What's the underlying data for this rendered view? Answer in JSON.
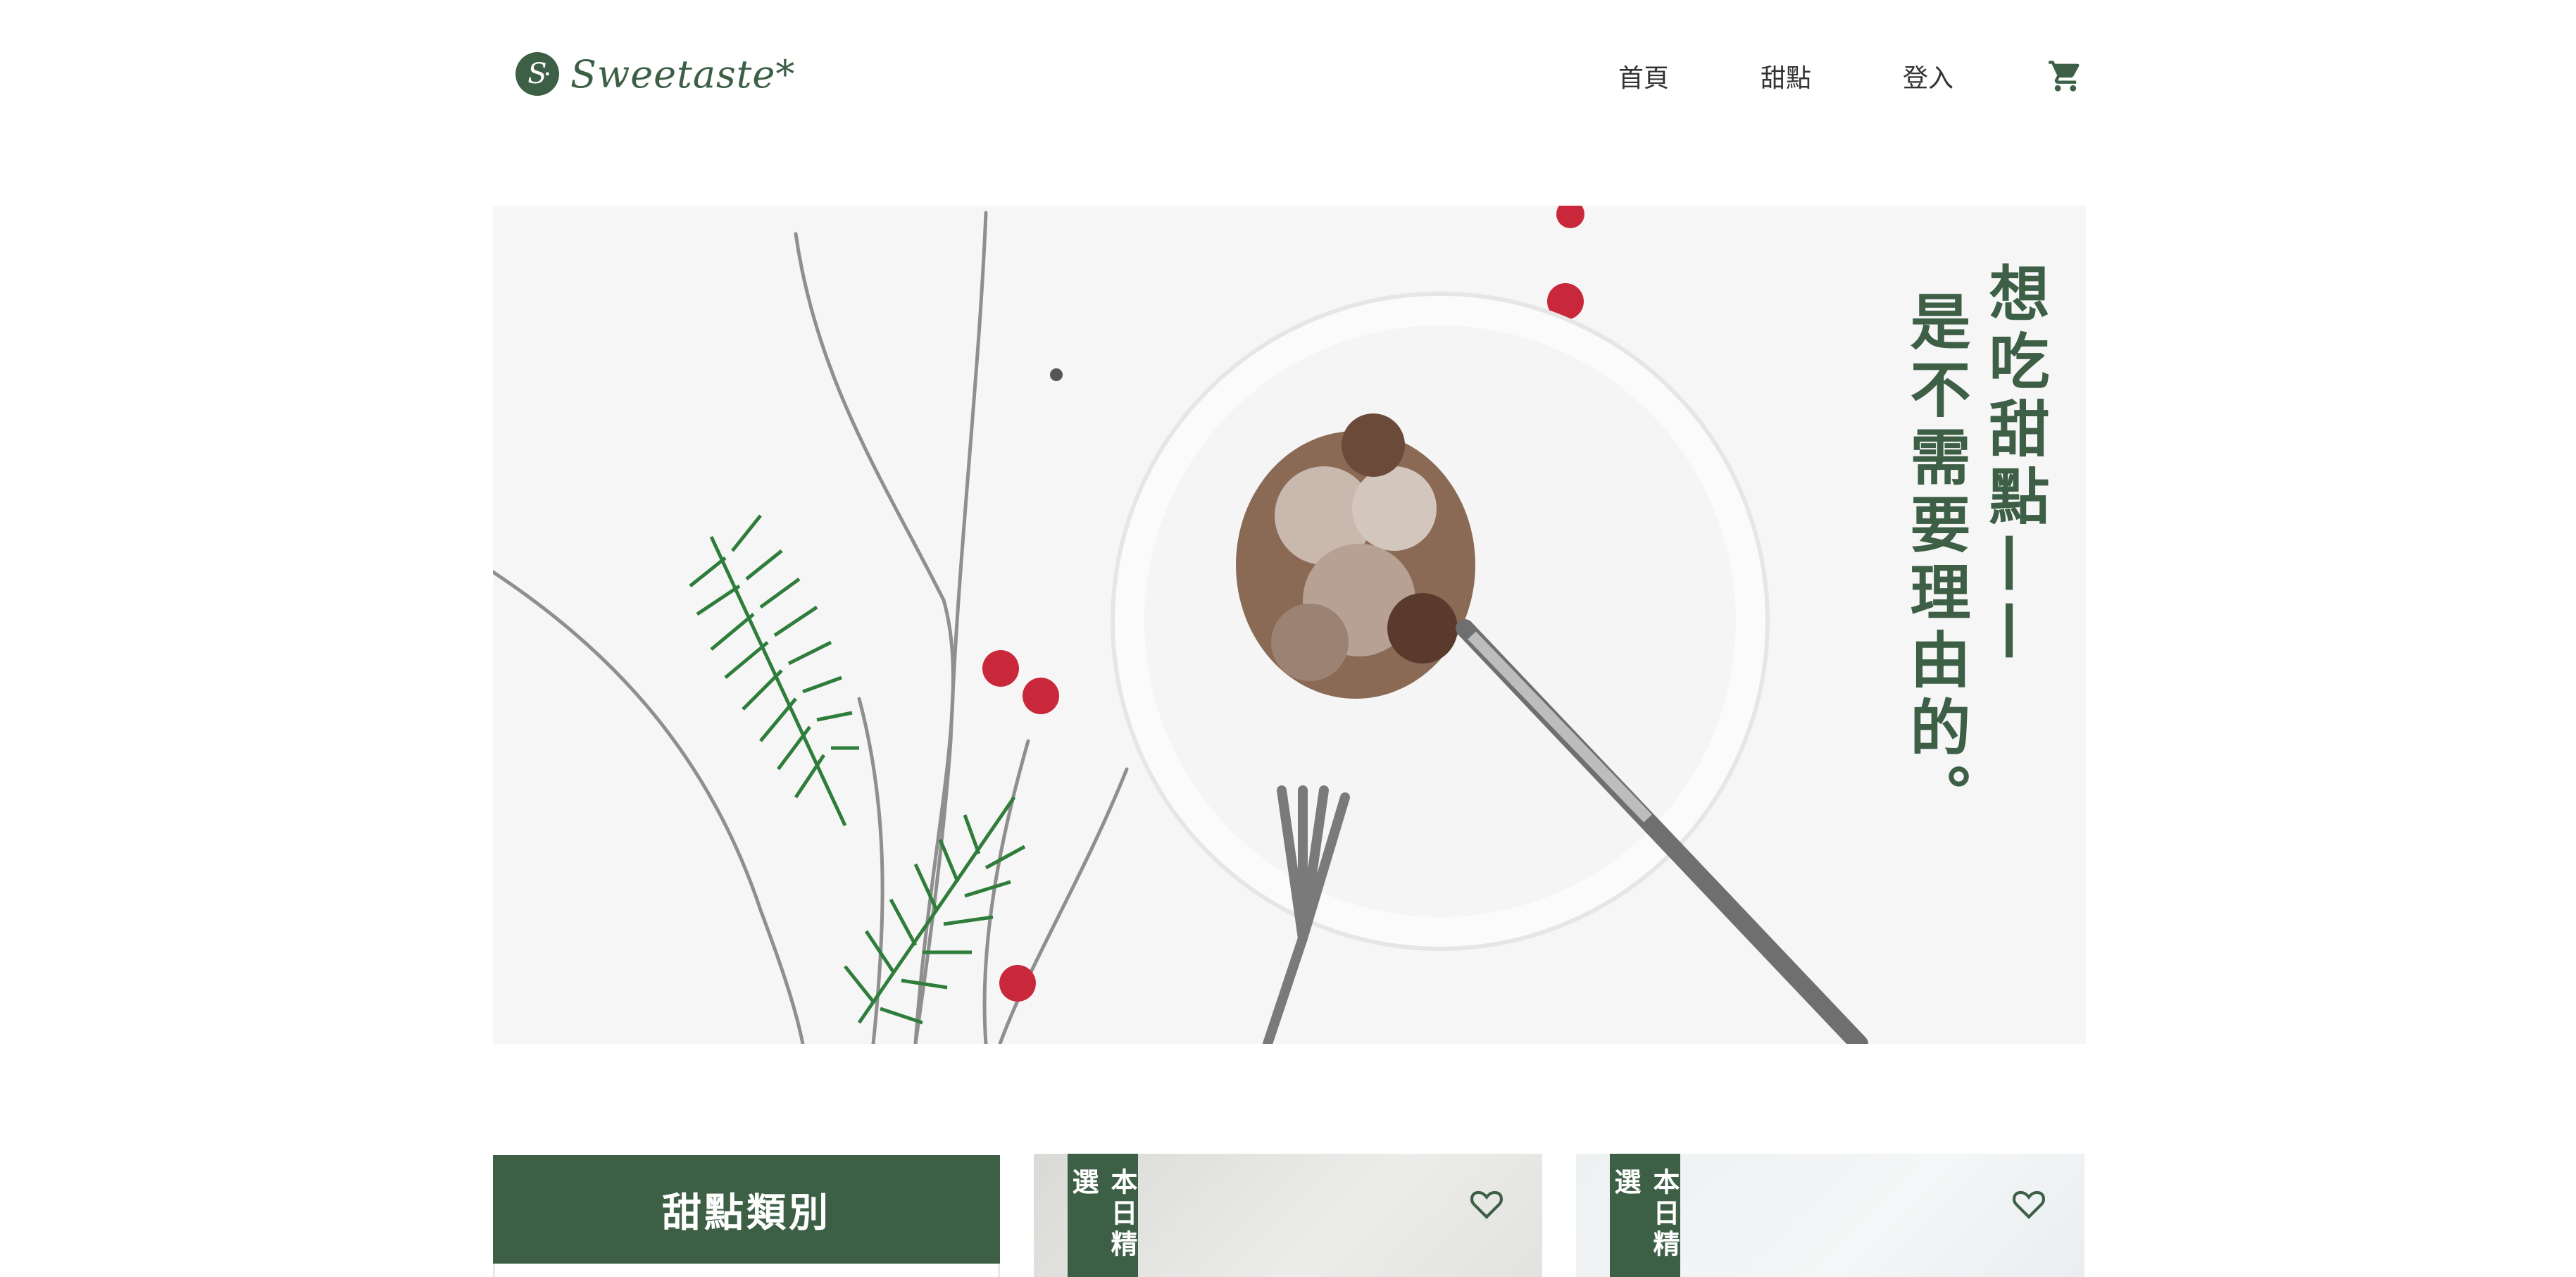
{
  "header": {
    "logo_mark": "S",
    "logo_text": "Sweetaste*",
    "nav": [
      {
        "label": "首頁"
      },
      {
        "label": "甜點"
      },
      {
        "label": "登入"
      }
    ],
    "cart_icon": "shopping-cart-icon"
  },
  "hero": {
    "line1": "想吃甜點——",
    "line2": "是不需要理由的。"
  },
  "category_card": {
    "title": "甜點類別"
  },
  "products": [
    {
      "badge": "本日精選",
      "favorite_icon": "heart-outline-icon"
    },
    {
      "badge": "本日精選",
      "favorite_icon": "heart-outline-icon"
    }
  ],
  "colors": {
    "brand_green": "#3d5f45",
    "text": "#333333",
    "hero_bg": "#f7f6f7"
  }
}
